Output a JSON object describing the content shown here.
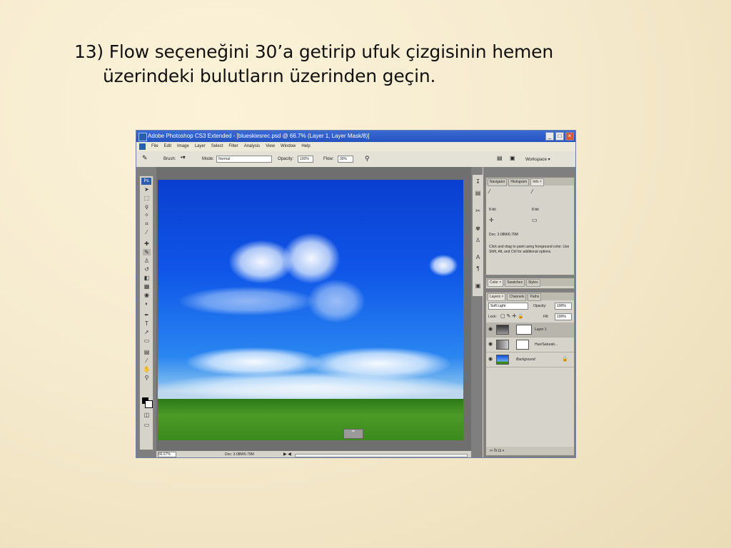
{
  "slide": {
    "line1": "13) Flow seçeneğini 30’a getirip ufuk çizgisinin hemen",
    "line2": "üzerindeki bulutların üzerinden geçin."
  },
  "window": {
    "title": "Adobe Photoshop CS3 Extended - [blueskiesrec.psd @ 66.7% (Layer 1, Layer Mask/8)]",
    "minimize": "_",
    "maximize": "□",
    "close": "×"
  },
  "menu": [
    "File",
    "Edit",
    "Image",
    "Layer",
    "Select",
    "Filter",
    "Analysis",
    "View",
    "Window",
    "Help"
  ],
  "options": {
    "brush_label": "Brush:",
    "mode_label": "Mode:",
    "mode_value": "Normal",
    "opacity_label": "Opacity:",
    "opacity_value": "100%",
    "flow_label": "Flow:",
    "flow_value": "30%",
    "workspace": "Workspace ▾"
  },
  "status": {
    "zoom": "66.67%",
    "doc": "Doc: 3.08M/6.79M"
  },
  "info_panel": {
    "tabs": [
      "Navigator",
      "Histogram",
      "Info ×"
    ],
    "doc": "Doc: 3.08M/6.79M",
    "hint": "Click and drag to paint using foreground color. Use Shift, Alt, and Ctrl for additional options.",
    "bit_left": "8-bit",
    "bit_right": "8-bit"
  },
  "color_panel": {
    "tabs": [
      "Color ×",
      "Swatches",
      "Styles"
    ]
  },
  "layers_panel": {
    "tabs": [
      "Layers ×",
      "Channels",
      "Paths"
    ],
    "blend_mode": "Soft Light",
    "opacity_label": "Opacity:",
    "opacity_value": "100%",
    "lock_label": "Lock:",
    "fill_label": "Fill:",
    "fill_value": "100%",
    "layers": [
      {
        "name": "Layer 1",
        "selected": true
      },
      {
        "name": "Hue/Saturati...",
        "selected": false
      },
      {
        "name": "Background",
        "selected": false
      }
    ]
  },
  "colors": {
    "title_bar": "#2553c0",
    "sky_top": "#0a3fd0",
    "grass": "#3b8a1e"
  }
}
